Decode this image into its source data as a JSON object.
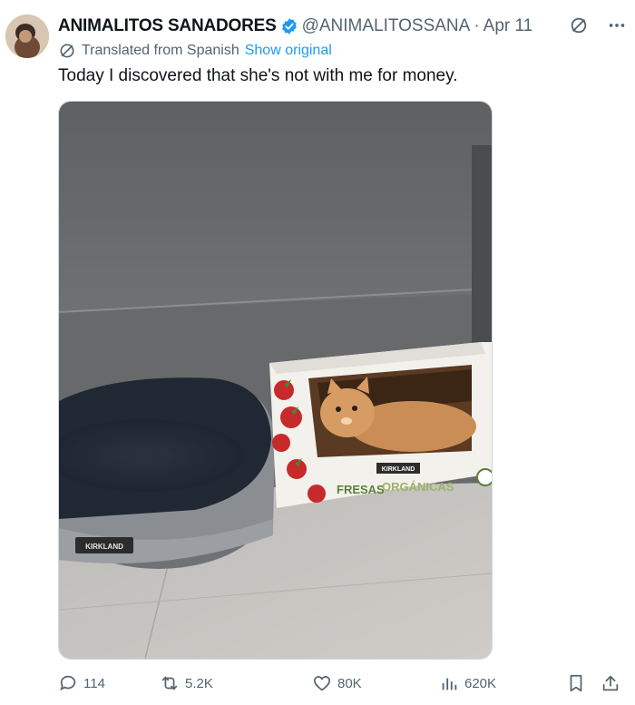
{
  "tweet": {
    "author_name": "ANIMALITOS SANADORES",
    "handle": "@ANIMALITOSSANA",
    "separator": "·",
    "date": "Apr 11",
    "translated_label": "Translated from Spanish",
    "show_original": "Show original",
    "text": "Today I discovered that she's not with me for money.",
    "media": {
      "bed_brand": "KIRKLAND",
      "box_brand": "KIRKLAND",
      "box_text_1": "FRESAS",
      "box_text_2": "ORGÁNICAS"
    }
  },
  "actions": {
    "replies": "114",
    "reposts": "5.2K",
    "likes": "80K",
    "views": "620K"
  },
  "icons": {
    "verified": "verified-badge-icon",
    "grok": "grok-icon",
    "more": "more-icon",
    "translate": "translate-icon",
    "reply": "reply-icon",
    "repost": "repost-icon",
    "like": "like-icon",
    "views": "views-icon",
    "bookmark": "bookmark-icon",
    "share": "share-icon"
  },
  "colors": {
    "link": "#1d9bf0",
    "secondary_text": "#536471",
    "primary_text": "#0f1419",
    "verified": "#1d9bf0"
  }
}
